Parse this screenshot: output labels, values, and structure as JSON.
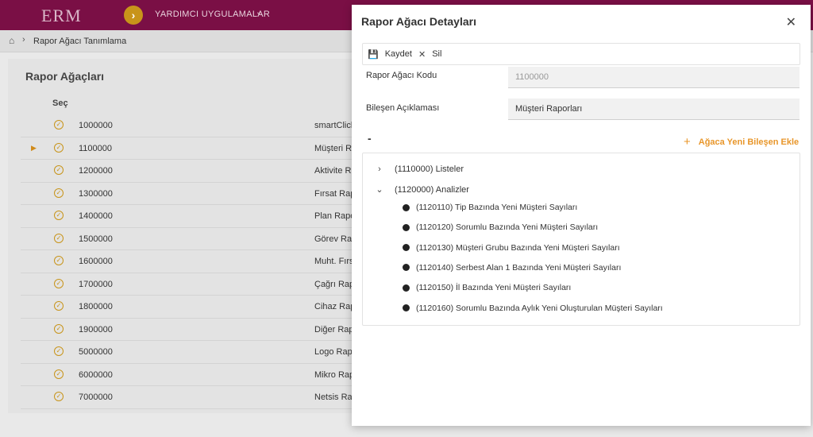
{
  "app": {
    "logo": "ERM",
    "menu_label": "YARDIMCI UYGULAMALAR"
  },
  "breadcrumb": {
    "current": "Rapor Ağacı Tanımlama"
  },
  "list": {
    "title": "Rapor Ağaçları",
    "select_header": "Seç",
    "rows": [
      {
        "code": "1000000",
        "name": "smartClick"
      },
      {
        "code": "1100000",
        "name": "Müşteri Ra"
      },
      {
        "code": "1200000",
        "name": "Aktivite Ra"
      },
      {
        "code": "1300000",
        "name": "Fırsat Rap"
      },
      {
        "code": "1400000",
        "name": "Plan Rapo"
      },
      {
        "code": "1500000",
        "name": "Görev Rap"
      },
      {
        "code": "1600000",
        "name": "Muht. Fırs"
      },
      {
        "code": "1700000",
        "name": "Çağrı Rapo"
      },
      {
        "code": "1800000",
        "name": "Cihaz Rap"
      },
      {
        "code": "1900000",
        "name": "Diğer Rap"
      },
      {
        "code": "5000000",
        "name": "Logo Rapo"
      },
      {
        "code": "6000000",
        "name": "Mikro Rap"
      },
      {
        "code": "7000000",
        "name": "Netsis Rap"
      }
    ]
  },
  "modal": {
    "title": "Rapor Ağacı Detayları",
    "toolbar": {
      "save_label": "Kaydet",
      "delete_label": "Sil"
    },
    "fields": {
      "code_label": "Rapor Ağacı Kodu",
      "code_value": "1100000",
      "desc_label": "Bileşen Açıklaması",
      "desc_value": "Müşteri Raporları"
    },
    "collapse_symbol": "-",
    "add_label": "Ağaca Yeni Bileşen Ekle",
    "tree": {
      "nodes": [
        {
          "label": "(1110000) Listeler",
          "expanded": false
        },
        {
          "label": "(1120000) Analizler",
          "expanded": true
        }
      ],
      "children": [
        "(1120110) Tip Bazında Yeni Müşteri Sayıları",
        "(1120120) Sorumlu Bazında Yeni Müşteri Sayıları",
        "(1120130) Müşteri Grubu Bazında Yeni Müşteri Sayıları",
        "(1120140) Serbest Alan 1 Bazında Yeni Müşteri Sayıları",
        "(1120150) İl Bazında Yeni Müşteri Sayıları",
        "(1120160) Sorumlu Bazında Aylık Yeni Oluşturulan Müşteri Sayıları"
      ]
    }
  },
  "colors": {
    "topbar": "#7a0f45",
    "accent": "#c8941a",
    "add_button": "#e8962a"
  },
  "icons": {
    "home": "home-icon",
    "menu": "chevron-right-icon",
    "save": "floppy-disk-icon",
    "delete": "close-icon",
    "close": "close-icon",
    "add": "plus-icon",
    "collapsed": "chevron-right-icon",
    "expanded": "chevron-down-icon"
  }
}
